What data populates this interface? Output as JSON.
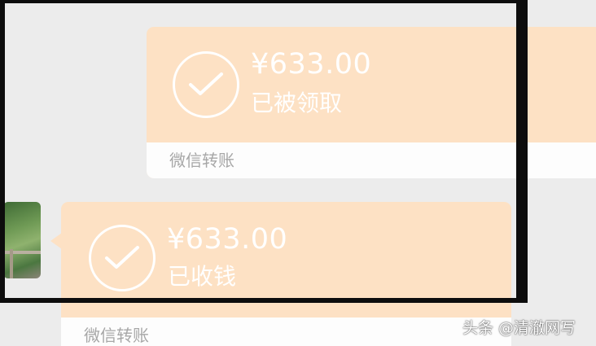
{
  "messages": [
    {
      "amount": "¥633.00",
      "status": "已被领取",
      "footer_label": "微信转账"
    },
    {
      "amount": "¥633.00",
      "status": "已收钱",
      "footer_label": "微信转账"
    }
  ],
  "watermark": "头条 @清澈网写",
  "colors": {
    "card_bg": "#fde1c4",
    "footer_bg": "#fdfdfd",
    "chat_bg": "#ececec",
    "check_icon": "#ffffff"
  },
  "icons": {
    "status": "check-circle-icon"
  }
}
